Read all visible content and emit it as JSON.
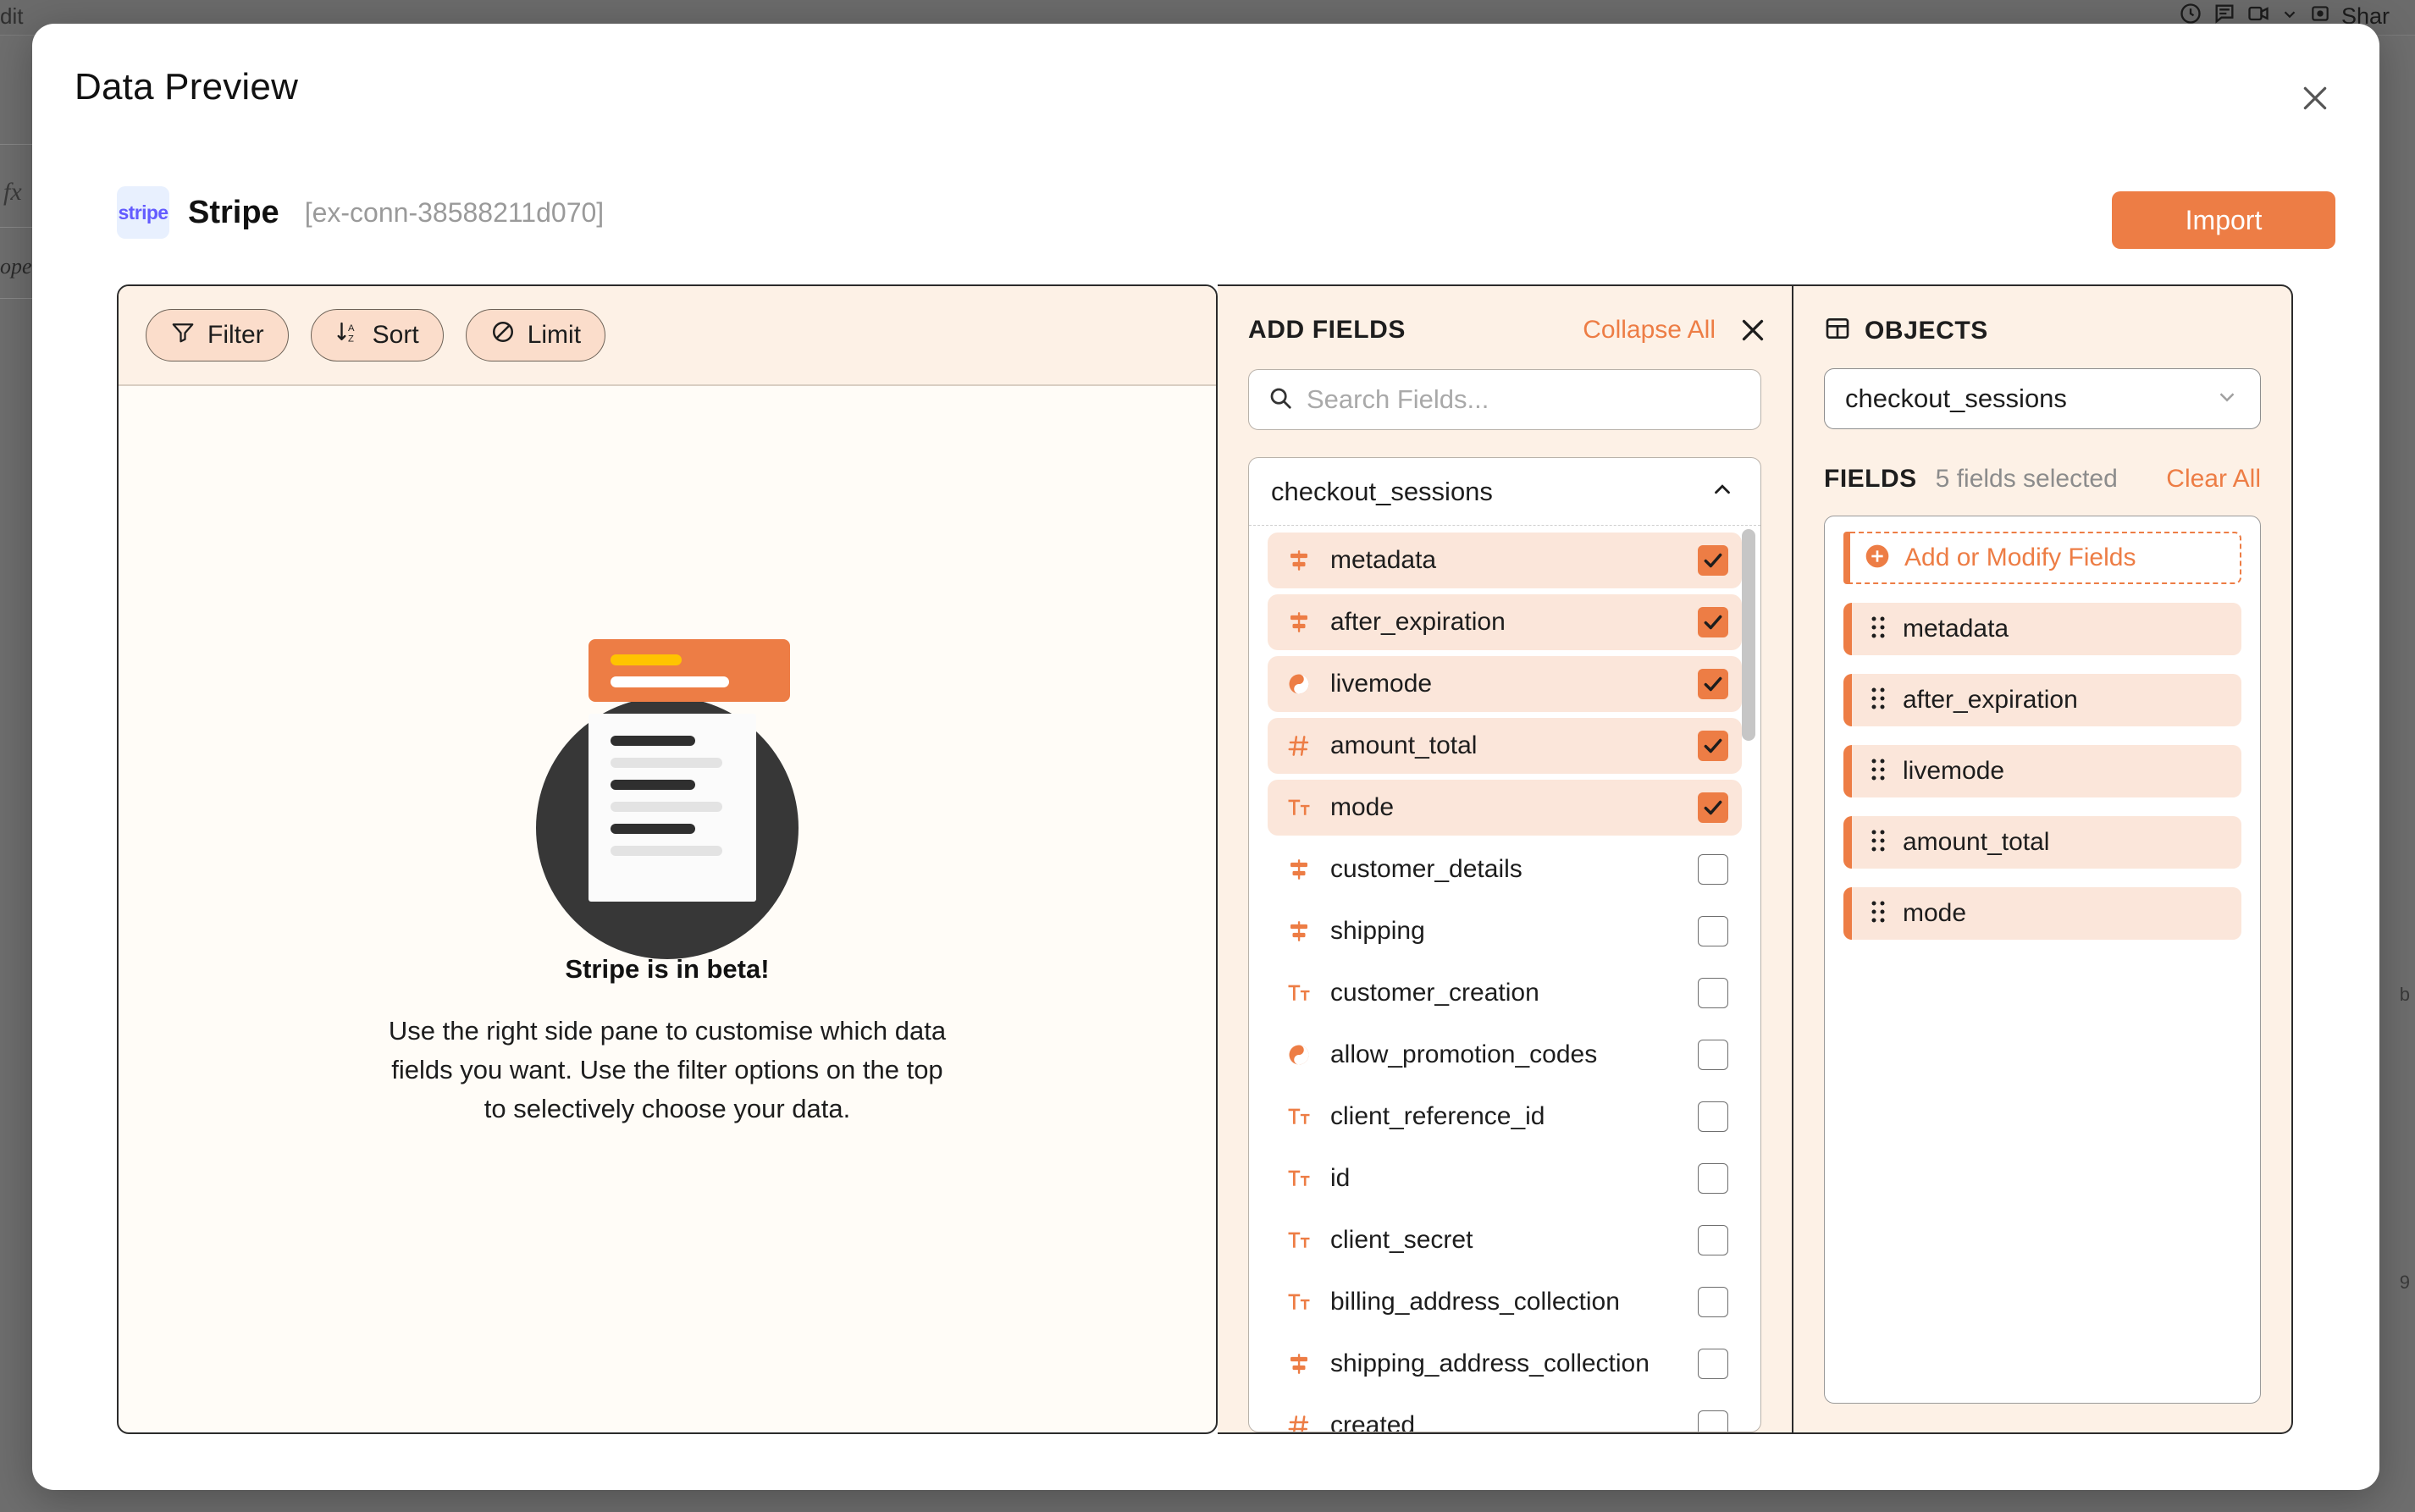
{
  "background": {
    "menu_text": "dit",
    "formula_icon": "fx",
    "operand_text": "ope",
    "share_label": "Shar",
    "right_labels": [
      "b",
      "9"
    ],
    "icons": [
      "history-icon",
      "comment-icon",
      "meet-icon",
      "chevron-down-icon",
      "present-icon"
    ]
  },
  "modal": {
    "title": "Data Preview",
    "close_icon": "close-icon"
  },
  "connector": {
    "logo_text": "stripe",
    "name": "Stripe",
    "id": "[ex-conn-38588211d070]"
  },
  "actions": {
    "import_label": "Import"
  },
  "preview": {
    "toolbar": [
      {
        "label": "Filter",
        "icon": "funnel-icon"
      },
      {
        "label": "Sort",
        "icon": "sort-az-icon"
      },
      {
        "label": "Limit",
        "icon": "no-entry-icon"
      }
    ],
    "empty_title": "Stripe is in beta!",
    "empty_body": "Use the right side pane to customise which data fields you want. Use the filter options on the top to selectively choose your data."
  },
  "add_fields": {
    "title": "ADD FIELDS",
    "collapse_all": "Collapse All",
    "close_icon": "close-icon",
    "search_placeholder": "Search Fields...",
    "search_value": "",
    "search_icon": "search-icon",
    "group_name": "checkout_sessions",
    "group_chevron": "chevron-up-icon",
    "items": [
      {
        "name": "metadata",
        "type": "object",
        "checked": true
      },
      {
        "name": "after_expiration",
        "type": "object",
        "checked": true
      },
      {
        "name": "livemode",
        "type": "boolean",
        "checked": true
      },
      {
        "name": "amount_total",
        "type": "number",
        "checked": true
      },
      {
        "name": "mode",
        "type": "text",
        "checked": true
      },
      {
        "name": "customer_details",
        "type": "object",
        "checked": false
      },
      {
        "name": "shipping",
        "type": "object",
        "checked": false
      },
      {
        "name": "customer_creation",
        "type": "text",
        "checked": false
      },
      {
        "name": "allow_promotion_codes",
        "type": "boolean",
        "checked": false
      },
      {
        "name": "client_reference_id",
        "type": "text",
        "checked": false
      },
      {
        "name": "id",
        "type": "text",
        "checked": false
      },
      {
        "name": "client_secret",
        "type": "text",
        "checked": false
      },
      {
        "name": "billing_address_collection",
        "type": "text",
        "checked": false
      },
      {
        "name": "shipping_address_collection",
        "type": "object",
        "checked": false
      },
      {
        "name": "created",
        "type": "number",
        "checked": false
      }
    ]
  },
  "objects": {
    "title": "OBJECTS",
    "title_icon": "table-icon",
    "selected_object": "checkout_sessions",
    "select_chevron": "chevron-down-icon",
    "fields_label": "FIELDS",
    "fields_count": "5 fields selected",
    "clear_all": "Clear All",
    "add_modify_label": "Add or Modify Fields",
    "add_modify_icon": "plus-circle-icon",
    "chips": [
      {
        "label": "metadata"
      },
      {
        "label": "after_expiration"
      },
      {
        "label": "livemode"
      },
      {
        "label": "amount_total"
      },
      {
        "label": "mode"
      }
    ]
  },
  "colors": {
    "accent": "#ed7d45",
    "panel_bg": "#fdf1e6",
    "chip_bg": "#fbe6da",
    "preview_bg": "#fffcf7"
  }
}
